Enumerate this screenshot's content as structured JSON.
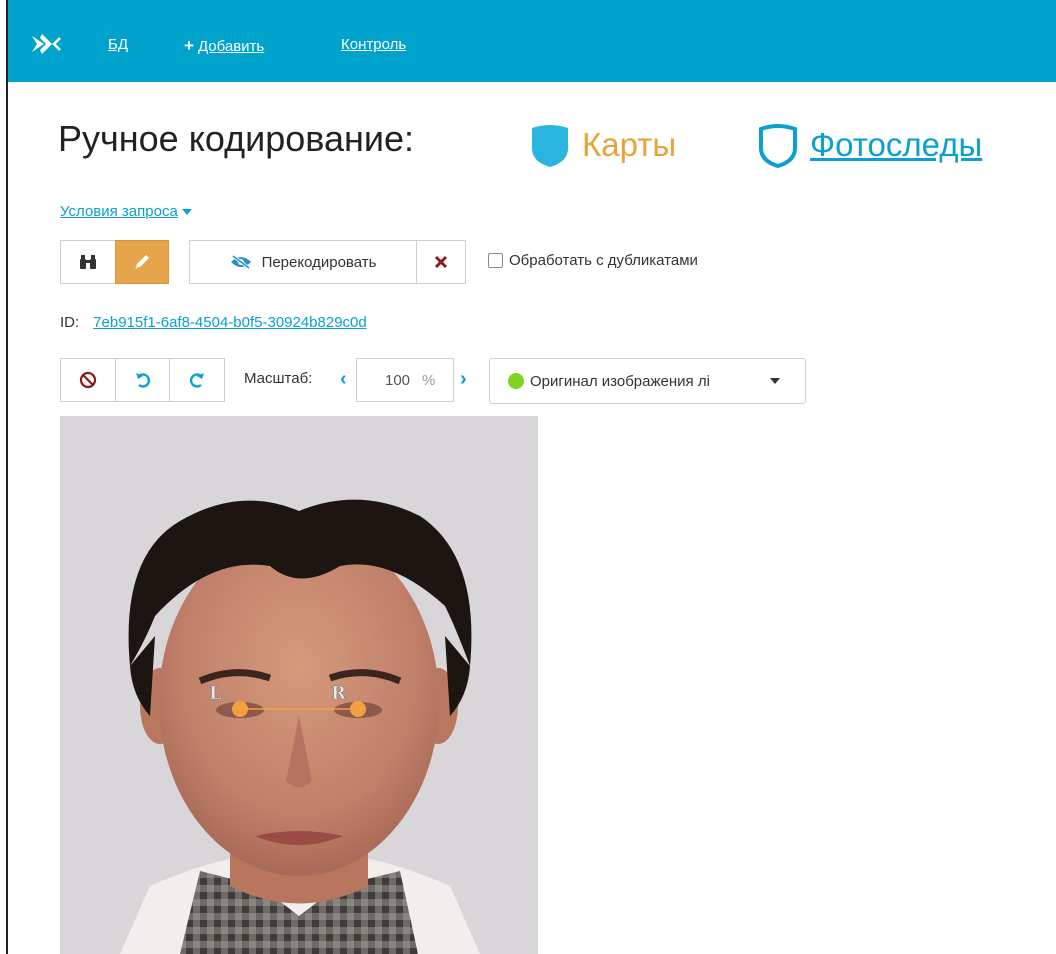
{
  "nav": {
    "items": [
      {
        "label": "БД"
      },
      {
        "label": "Добавить",
        "prefix": "+"
      },
      {
        "label": "Контроль"
      }
    ]
  },
  "header": {
    "title": "Ручное кодирование:",
    "maps_label": "Карты",
    "photo_label": "Фотоследы"
  },
  "query": {
    "conditions_label": "Условия запроса"
  },
  "toolbar": {
    "recode_label": "Перекодировать",
    "duplicates_label": "Обработать с дубликатами"
  },
  "record": {
    "id_label": "ID:",
    "id_value": "7eb915f1-6af8-4504-b0f5-30924b829c0d"
  },
  "viewer": {
    "scale_label": "Масштаб:",
    "scale_value": "100",
    "scale_unit": "%",
    "source_select": "Оригинал изображения лі"
  },
  "landmarks": {
    "left_label": "L",
    "right_label": "R"
  },
  "colors": {
    "topbar": "#00a3cc",
    "accent_orange": "#e7a54b",
    "link_blue": "#0aa0d0",
    "status_green": "#7ed321",
    "danger": "#8b1a1a"
  },
  "icons": [
    "logo-icon",
    "binoculars-icon",
    "pencil-icon",
    "eye-slash-icon",
    "close-icon",
    "ban-icon",
    "undo-icon",
    "redo-icon",
    "chevron-left-icon",
    "chevron-right-icon",
    "caret-down-icon",
    "maps-shield-icon",
    "photo-shield-icon"
  ]
}
